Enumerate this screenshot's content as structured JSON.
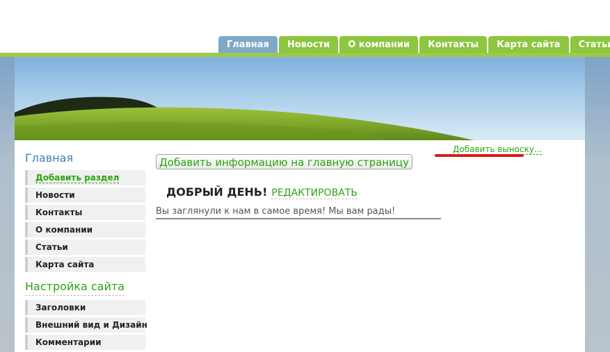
{
  "nav": {
    "tabs": [
      {
        "label": "Главная",
        "active": true
      },
      {
        "label": "Новости",
        "active": false
      },
      {
        "label": "О компании",
        "active": false
      },
      {
        "label": "Контакты",
        "active": false
      },
      {
        "label": "Карта сайта",
        "active": false
      },
      {
        "label": "Статьи",
        "active": false
      }
    ]
  },
  "sidebar": {
    "heading": "Главная",
    "items": [
      {
        "label": "Добавить раздел"
      },
      {
        "label": "Новости"
      },
      {
        "label": "Контакты"
      },
      {
        "label": "О компании"
      },
      {
        "label": "Статьи"
      },
      {
        "label": "Карта сайта"
      }
    ],
    "settings_heading": "Настройка сайта",
    "settings_items": [
      {
        "label": "Заголовки"
      },
      {
        "label": "Внешний вид и Дизайн"
      },
      {
        "label": "Комментарии"
      }
    ]
  },
  "main": {
    "add_info_button": "Добавить информацию на главную страницу",
    "greeting_title": "ДОБРЫЙ ДЕНЬ!",
    "edit_link": "РЕДАКТИРОВАТЬ",
    "welcome_text": "Вы заглянули к нам в самое время! Мы вам рады!",
    "callout_link": "Добавить выноску..."
  },
  "colors": {
    "nav_tab": "#8dc63f",
    "nav_tab_active": "#7fa9c9",
    "accent_green": "#2aa312",
    "heading_blue": "#3f7fb8",
    "highlight_red": "#e01818"
  }
}
